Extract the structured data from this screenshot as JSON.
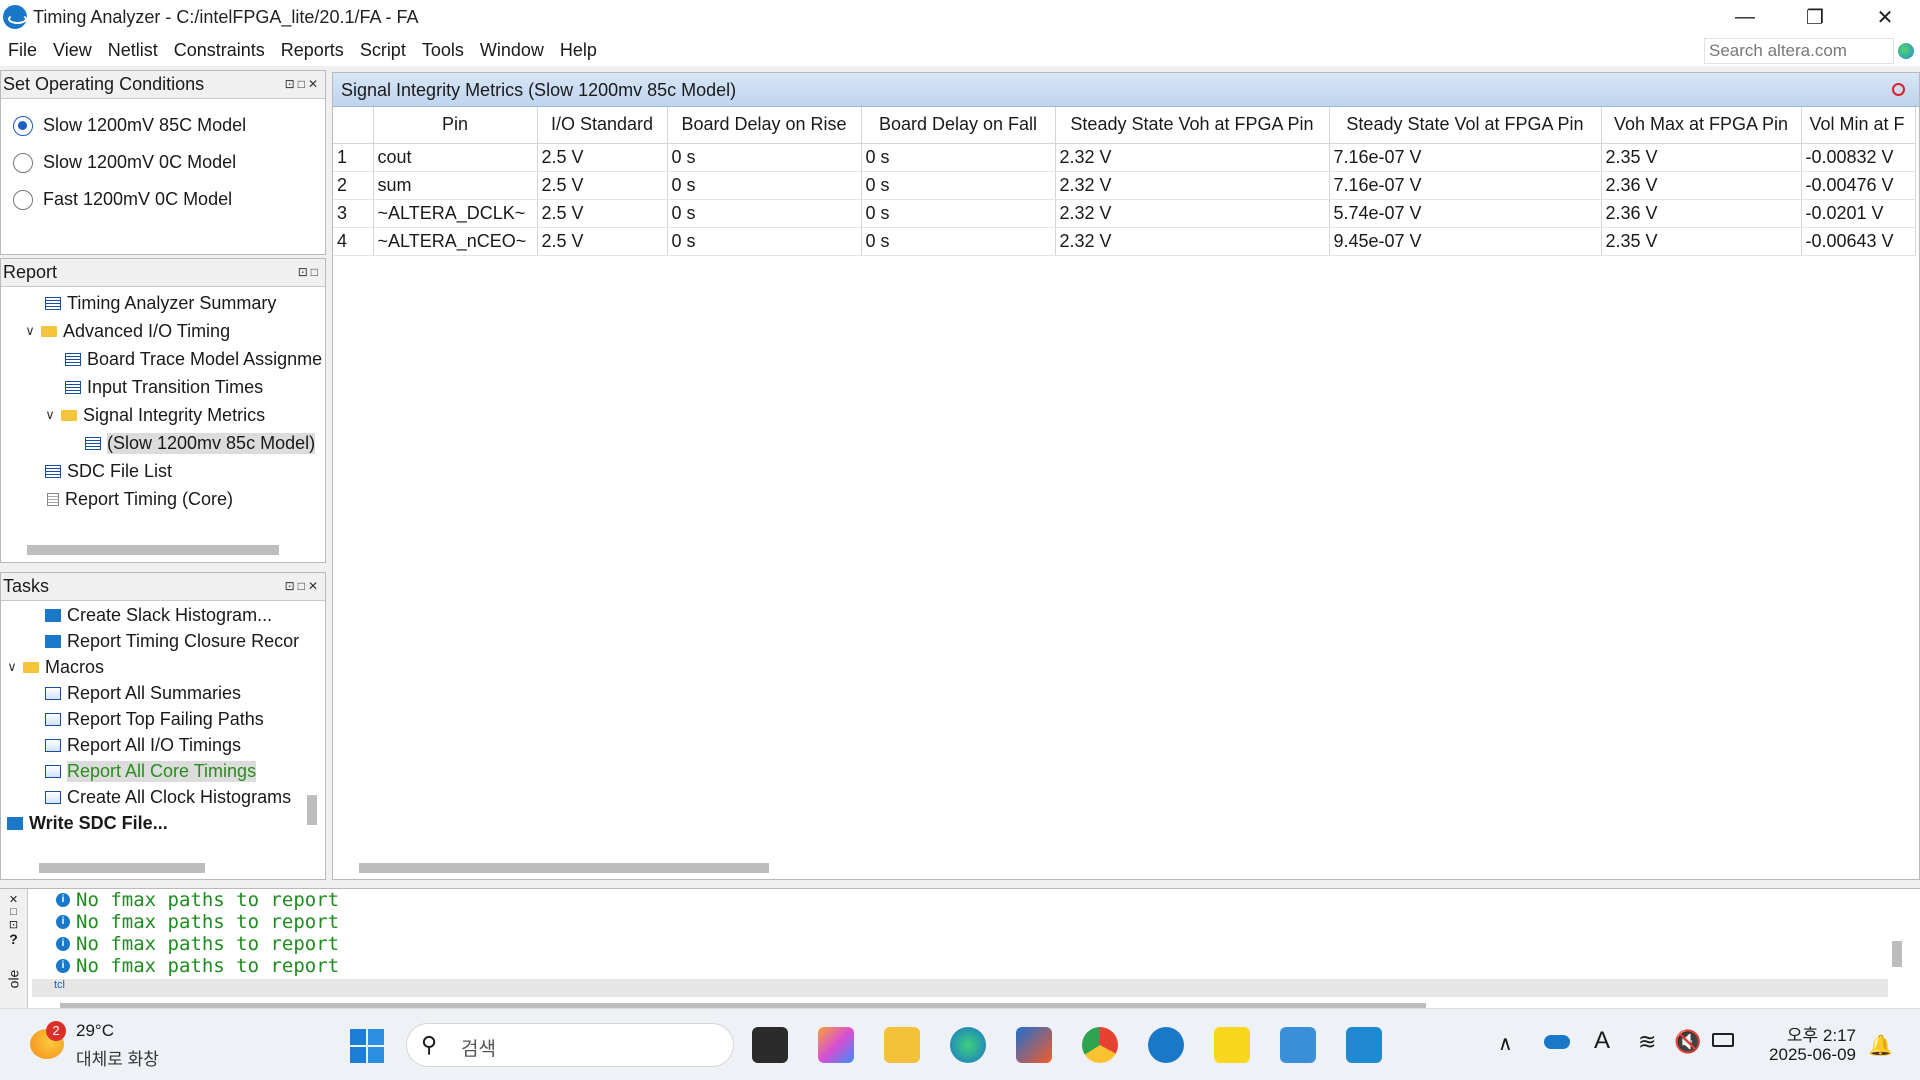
{
  "window": {
    "title": "Timing Analyzer - C:/intelFPGA_lite/20.1/FA - FA"
  },
  "menu": [
    "File",
    "View",
    "Netlist",
    "Constraints",
    "Reports",
    "Script",
    "Tools",
    "Window",
    "Help"
  ],
  "search": {
    "placeholder": "Search altera.com"
  },
  "conditions": {
    "title": "Set Operating Conditions",
    "options": [
      "Slow 1200mV 85C Model",
      "Slow 1200mV 0C Model",
      "Fast 1200mV 0C Model"
    ],
    "selected_index": 0
  },
  "report": {
    "title": "Report",
    "items": [
      {
        "label": "Timing Analyzer Summary"
      },
      {
        "label": "Advanced I/O Timing"
      },
      {
        "label": "Board Trace Model Assignme"
      },
      {
        "label": "Input Transition Times"
      },
      {
        "label": "Signal Integrity Metrics"
      },
      {
        "label": "(Slow 1200mv 85c Model)"
      },
      {
        "label": "SDC File List"
      },
      {
        "label": "Report Timing (Core)"
      }
    ]
  },
  "tasks": {
    "title": "Tasks",
    "items": [
      {
        "label": "Create Slack Histogram..."
      },
      {
        "label": "Report Timing Closure Recor"
      },
      {
        "label": "Macros"
      },
      {
        "label": "Report All Summaries"
      },
      {
        "label": "Report Top Failing Paths"
      },
      {
        "label": "Report All I/O Timings"
      },
      {
        "label": "Report All Core Timings"
      },
      {
        "label": "Create All Clock Histograms"
      },
      {
        "label": "Write SDC File..."
      }
    ]
  },
  "main": {
    "title": "Signal Integrity Metrics (Slow 1200mv 85c Model)",
    "columns": [
      "Pin",
      "I/O Standard",
      "Board Delay on Rise",
      "Board Delay on Fall",
      "Steady State Voh at FPGA Pin",
      "Steady State Vol at FPGA Pin",
      "Voh Max at FPGA Pin",
      "Vol Min at F"
    ],
    "rows": [
      {
        "idx": "1",
        "cells": [
          "cout",
          "2.5 V",
          "0 s",
          "0 s",
          "2.32 V",
          "7.16e-07 V",
          "2.35 V",
          "-0.00832 V"
        ]
      },
      {
        "idx": "2",
        "cells": [
          "sum",
          "2.5 V",
          "0 s",
          "0 s",
          "2.32 V",
          "7.16e-07 V",
          "2.36 V",
          "-0.00476 V"
        ]
      },
      {
        "idx": "3",
        "cells": [
          "~ALTERA_DCLK~",
          "2.5 V",
          "0 s",
          "0 s",
          "2.32 V",
          "5.74e-07 V",
          "2.36 V",
          "-0.0201 V"
        ]
      },
      {
        "idx": "4",
        "cells": [
          "~ALTERA_nCEO~",
          "2.5 V",
          "0 s",
          "0 s",
          "2.32 V",
          "9.45e-07 V",
          "2.35 V",
          "-0.00643 V"
        ]
      }
    ]
  },
  "console": {
    "lines": [
      "No fmax paths to report",
      "No fmax paths to report",
      "No fmax paths to report",
      "No fmax paths to report"
    ],
    "prompt": "tcl",
    "side_label": "ole"
  },
  "taskbar": {
    "weather_temp": "29°C",
    "weather_desc": "대체로 화창",
    "weather_badge": "2",
    "search_placeholder": "검색",
    "time": "오후 2:17",
    "date": "2025-06-09",
    "ime": "A"
  }
}
